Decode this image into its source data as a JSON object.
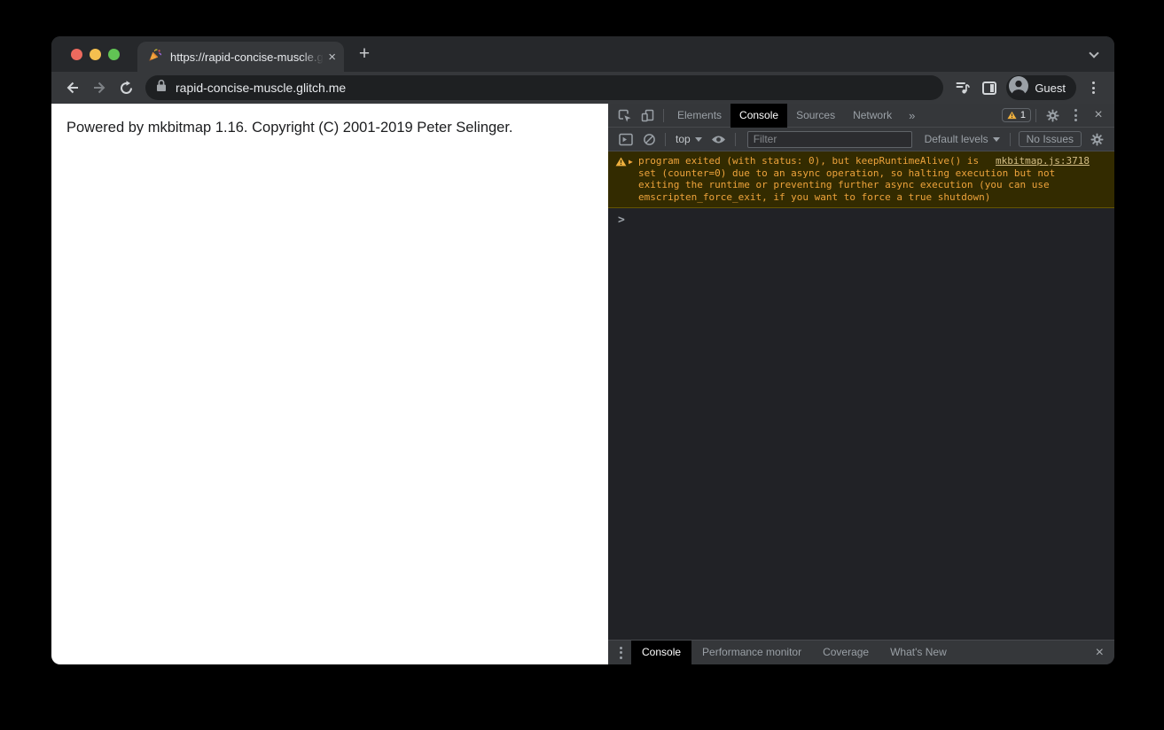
{
  "browser": {
    "tab_title": "https://rapid-concise-muscle.g",
    "new_tab": "+",
    "close_tab": "×",
    "url": "rapid-concise-muscle.glitch.me",
    "profile_label": "Guest"
  },
  "page": {
    "text": "Powered by mkbitmap 1.16. Copyright (C) 2001-2019 Peter Selinger."
  },
  "devtools": {
    "tabs": {
      "elements": "Elements",
      "console": "Console",
      "sources": "Sources",
      "network": "Network",
      "more": "»"
    },
    "warning_badge_count": "1",
    "close": "×",
    "toolbar": {
      "context": "top",
      "filter_placeholder": "Filter",
      "levels": "Default levels",
      "issues": "No Issues"
    },
    "console": {
      "message_lines": [
        "program exited (with status: 0), but keepRuntimeAlive() is",
        "set (counter=0) due to an async operation, so halting execution but not",
        "exiting the runtime or preventing further async execution (you can use",
        "emscripten_force_exit, if you want to force a true shutdown)"
      ],
      "disclosure": "▶",
      "source_link": "mkbitmap.js:3718",
      "prompt": ">"
    },
    "drawer": {
      "console": "Console",
      "performance_monitor": "Performance monitor",
      "coverage": "Coverage",
      "whats_new": "What's New",
      "close": "×"
    }
  },
  "colors": {
    "warning_bg": "#332b00",
    "warning_border": "#655500",
    "warning_text": "#eda33b",
    "warning_link": "#d3bd86",
    "traffic_red": "#ed6a5e",
    "traffic_yellow": "#f4bf4f",
    "traffic_green": "#61c454",
    "devtools_toolbar": "#35373a",
    "console_bg": "#212226"
  }
}
